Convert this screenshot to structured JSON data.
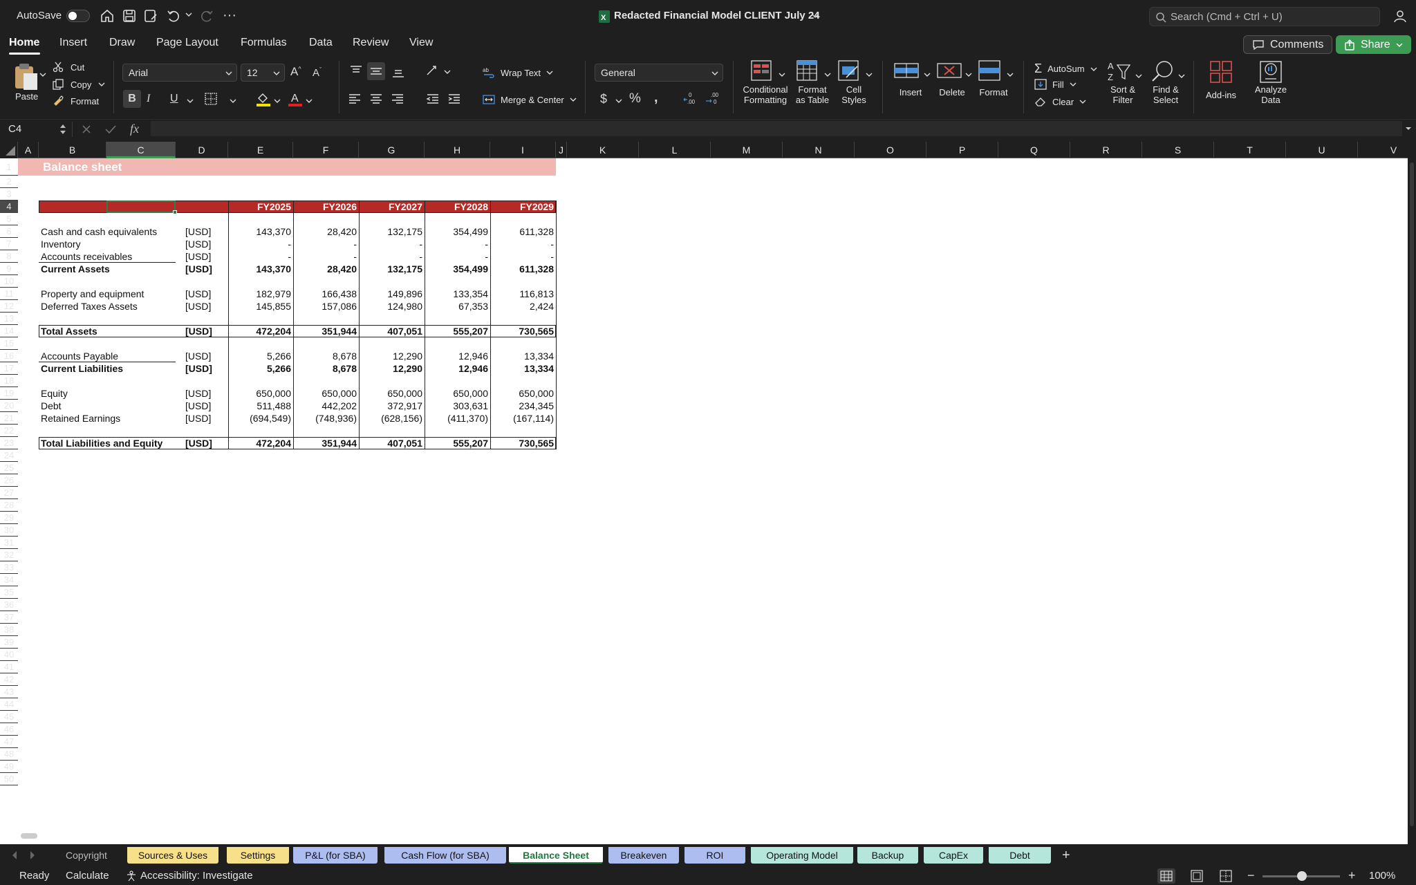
{
  "titlebar": {
    "autosave_label": "AutoSave",
    "document_title": "Redacted Financial Model CLIENT July 24",
    "search_placeholder": "Search (Cmd + Ctrl + U)"
  },
  "menu": {
    "items": [
      "Home",
      "Insert",
      "Draw",
      "Page Layout",
      "Formulas",
      "Data",
      "Review",
      "View"
    ],
    "active": "Home",
    "comments_label": "Comments",
    "share_label": "Share"
  },
  "ribbon": {
    "paste": "Paste",
    "cut": "Cut",
    "copy": "Copy",
    "format_painter": "Format",
    "font_name": "Arial",
    "font_size": "12",
    "bold": "B",
    "italic": "I",
    "underline": "U",
    "wrap_text": "Wrap Text",
    "merge_center": "Merge & Center",
    "number_format": "General",
    "conditional_formatting": [
      "Conditional",
      "Formatting"
    ],
    "format_as_table": [
      "Format",
      "as Table"
    ],
    "cell_styles": [
      "Cell",
      "Styles"
    ],
    "insert": "Insert",
    "delete": "Delete",
    "format": "Format",
    "autosum": "AutoSum",
    "fill": "Fill",
    "clear": "Clear",
    "sort_filter": [
      "Sort &",
      "Filter"
    ],
    "find_select": [
      "Find &",
      "Select"
    ],
    "add_ins": "Add-ins",
    "analyze_data": [
      "Analyze",
      "Data"
    ],
    "accent_red": "#d9534f",
    "accent_blue": "#4a90d9"
  },
  "formula_bar": {
    "name_box": "C4",
    "fx": "fx",
    "content": ""
  },
  "sheet": {
    "columns": [
      "A",
      "B",
      "C",
      "D",
      "E",
      "F",
      "G",
      "H",
      "I",
      "J",
      "K",
      "L",
      "M",
      "N",
      "O",
      "P",
      "Q",
      "R",
      "S",
      "T",
      "U",
      "V"
    ],
    "selected_column": "C",
    "selected_row": "4",
    "title": "Balance sheet",
    "years": [
      "FY2025",
      "FY2026",
      "FY2027",
      "FY2028",
      "FY2029"
    ],
    "unit": "[USD]",
    "rows": [
      {
        "row": "6",
        "label": "Cash and cash equivalents",
        "values": [
          "143,370",
          "28,420",
          "132,175",
          "354,499",
          "611,328"
        ],
        "bold": false
      },
      {
        "row": "7",
        "label": "Inventory",
        "values": [
          "-",
          "-",
          "-",
          "-",
          "-"
        ],
        "bold": false
      },
      {
        "row": "8",
        "label": "Accounts receivables",
        "values": [
          "-",
          "-",
          "-",
          "-",
          "-"
        ],
        "bold": false
      },
      {
        "row": "9",
        "label": "Current Assets",
        "values": [
          "143,370",
          "28,420",
          "132,175",
          "354,499",
          "611,328"
        ],
        "bold": true
      },
      {
        "row": "11",
        "label": "Property and equipment",
        "values": [
          "182,979",
          "166,438",
          "149,896",
          "133,354",
          "116,813"
        ],
        "bold": false
      },
      {
        "row": "12",
        "label": "Deferred Taxes Assets",
        "values": [
          "145,855",
          "157,086",
          "124,980",
          "67,353",
          "2,424"
        ],
        "bold": false
      },
      {
        "row": "14",
        "label": "Total Assets",
        "values": [
          "472,204",
          "351,944",
          "407,051",
          "555,207",
          "730,565"
        ],
        "bold": true
      },
      {
        "row": "16",
        "label": "Accounts Payable",
        "values": [
          "5,266",
          "8,678",
          "12,290",
          "12,946",
          "13,334"
        ],
        "bold": false
      },
      {
        "row": "17",
        "label": "Current Liabilities",
        "values": [
          "5,266",
          "8,678",
          "12,290",
          "12,946",
          "13,334"
        ],
        "bold": true
      },
      {
        "row": "19",
        "label": "Equity",
        "values": [
          "650,000",
          "650,000",
          "650,000",
          "650,000",
          "650,000"
        ],
        "bold": false
      },
      {
        "row": "20",
        "label": "Debt",
        "values": [
          "511,488",
          "442,202",
          "372,917",
          "303,631",
          "234,345"
        ],
        "bold": false
      },
      {
        "row": "21",
        "label": "Retained Earnings",
        "values": [
          "(694,549)",
          "(748,936)",
          "(628,156)",
          "(411,370)",
          "(167,114)"
        ],
        "bold": false
      },
      {
        "row": "23",
        "label": "Total Liabilities and Equity",
        "values": [
          "472,204",
          "351,944",
          "407,051",
          "555,207",
          "730,565"
        ],
        "bold": true
      }
    ],
    "header_red": "#b52a26",
    "title_pink": "#f0b7b3"
  },
  "tabs": [
    {
      "label": "Copyright",
      "color": "#1f1f1f",
      "text": "#bbbbbb"
    },
    {
      "label": "Sources & Uses",
      "color": "#f7e08a",
      "text": "#111111"
    },
    {
      "label": "Settings",
      "color": "#f7e08a",
      "text": "#111111"
    },
    {
      "label": "P&L (for SBA)",
      "color": "#aebdf0",
      "text": "#111111"
    },
    {
      "label": "Cash Flow (for SBA)",
      "color": "#aebdf0",
      "text": "#111111"
    },
    {
      "label": "Balance Sheet",
      "color": "#ffffff",
      "text": "#1d7a3e"
    },
    {
      "label": "Breakeven",
      "color": "#aebdf0",
      "text": "#111111"
    },
    {
      "label": "ROI",
      "color": "#aebdf0",
      "text": "#111111"
    },
    {
      "label": "Operating Model",
      "color": "#b4e6dc",
      "text": "#111111"
    },
    {
      "label": "Backup",
      "color": "#b4e6dc",
      "text": "#111111"
    },
    {
      "label": "CapEx",
      "color": "#b4e6dc",
      "text": "#111111"
    },
    {
      "label": "Debt",
      "color": "#b4e6dc",
      "text": "#111111"
    }
  ],
  "status": {
    "ready": "Ready",
    "calculate": "Calculate",
    "accessibility": "Accessibility: Investigate",
    "zoom": "100%"
  }
}
